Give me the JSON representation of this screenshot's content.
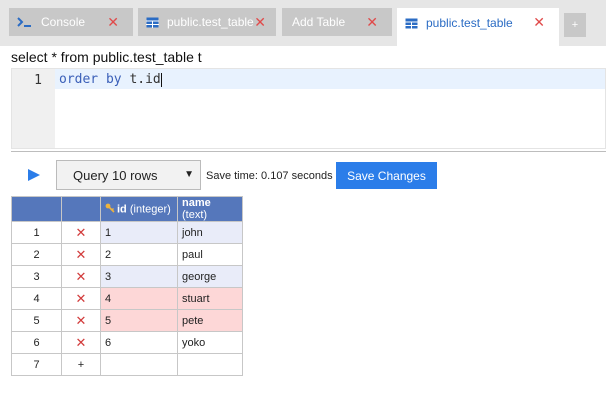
{
  "tabs": [
    {
      "label": "Console",
      "icon": "terminal-icon",
      "active": false
    },
    {
      "label": "public.test_table",
      "icon": "table-icon",
      "active": false
    },
    {
      "label": "Add Table",
      "icon": "",
      "active": false
    },
    {
      "label": "public.test_table",
      "icon": "table-icon",
      "active": true
    }
  ],
  "add_tab_label": "+",
  "close_glyph": "✕",
  "query": {
    "prefix_line": "select * from public.test_table t",
    "line_number": "1",
    "keyword_order": "order",
    "keyword_by": "by",
    "identifier": "t.id"
  },
  "toolbar": {
    "select_label": "Query 10 rows",
    "save_time": "Save time: 0.107 seconds",
    "save_label": "Save Changes"
  },
  "grid": {
    "columns": [
      {
        "name": "id",
        "type": "(integer)",
        "key": true
      },
      {
        "name": "name",
        "type": "(text)",
        "key": false
      }
    ],
    "rows": [
      {
        "num": "1",
        "id": "1",
        "name": "john",
        "state": "highlight"
      },
      {
        "num": "2",
        "id": "2",
        "name": "paul",
        "state": ""
      },
      {
        "num": "3",
        "id": "3",
        "name": "george",
        "state": "highlight"
      },
      {
        "num": "4",
        "id": "4",
        "name": "stuart",
        "state": "edited"
      },
      {
        "num": "5",
        "id": "5",
        "name": "pete",
        "state": "edited"
      },
      {
        "num": "6",
        "id": "6",
        "name": "yoko",
        "state": ""
      }
    ],
    "new_row": {
      "num": "7",
      "plus": "+"
    },
    "delete_glyph": "✕"
  },
  "colors": {
    "accent": "#2b7de9",
    "header_bg": "#5577bb",
    "edited_bg": "#fdd7d7",
    "delete": "#d23b3b"
  }
}
